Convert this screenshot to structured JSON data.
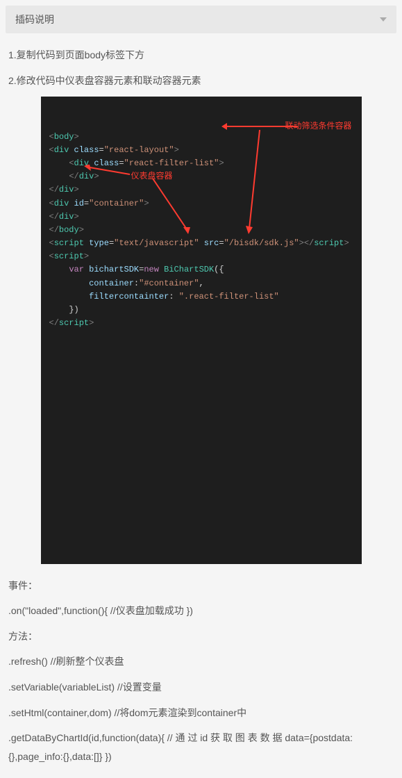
{
  "header": {
    "title": "插码说明"
  },
  "instructions": {
    "step1": "1.复制代码到页面body标签下方",
    "step2": "2.修改代码中仪表盘容器元素和联动容器元素"
  },
  "code_image": {
    "lines": [
      {
        "indent": 0,
        "tokens": [
          [
            "bracket",
            "<"
          ],
          [
            "tag",
            "body"
          ],
          [
            "bracket",
            ">"
          ]
        ]
      },
      {
        "indent": 0,
        "tokens": [
          [
            "bracket",
            "<"
          ],
          [
            "tag",
            "div"
          ],
          [
            "end",
            " "
          ],
          [
            "attr",
            "class"
          ],
          [
            "op",
            "="
          ],
          [
            "str",
            "\"react-layout\""
          ],
          [
            "bracket",
            ">"
          ]
        ]
      },
      {
        "indent": 2,
        "tokens": [
          [
            "bracket",
            "<"
          ],
          [
            "tag",
            "div"
          ],
          [
            "end",
            " "
          ],
          [
            "attr",
            "class"
          ],
          [
            "op",
            "="
          ],
          [
            "str",
            "\"react-filter-list\""
          ],
          [
            "bracket",
            ">"
          ]
        ]
      },
      {
        "indent": 2,
        "tokens": [
          [
            "bracket",
            "</"
          ],
          [
            "tag",
            "div"
          ],
          [
            "bracket",
            ">"
          ]
        ]
      },
      {
        "indent": 0,
        "tokens": [
          [
            "bracket",
            "</"
          ],
          [
            "tag",
            "div"
          ],
          [
            "bracket",
            ">"
          ]
        ]
      },
      {
        "indent": 0,
        "tokens": [
          [
            "bracket",
            "<"
          ],
          [
            "tag",
            "div"
          ],
          [
            "end",
            " "
          ],
          [
            "attr",
            "id"
          ],
          [
            "op",
            "="
          ],
          [
            "str",
            "\"container\""
          ],
          [
            "bracket",
            ">"
          ]
        ]
      },
      {
        "indent": 0,
        "tokens": [
          [
            "bracket",
            "</"
          ],
          [
            "tag",
            "div"
          ],
          [
            "bracket",
            ">"
          ]
        ]
      },
      {
        "indent": 0,
        "tokens": [
          [
            "bracket",
            "</"
          ],
          [
            "tag",
            "body"
          ],
          [
            "bracket",
            ">"
          ]
        ]
      },
      {
        "indent": 0,
        "tokens": [
          [
            "bracket",
            "<"
          ],
          [
            "tag",
            "script"
          ],
          [
            "end",
            " "
          ],
          [
            "attr",
            "type"
          ],
          [
            "op",
            "="
          ],
          [
            "str",
            "\"text/javascript\""
          ],
          [
            "end",
            " "
          ],
          [
            "attr",
            "src"
          ],
          [
            "op",
            "="
          ],
          [
            "str",
            "\"/bisdk/sdk.js\""
          ],
          [
            "bracket",
            ">"
          ],
          [
            "bracket",
            "</"
          ],
          [
            "tag",
            "script"
          ],
          [
            "bracket",
            ">"
          ]
        ]
      },
      {
        "indent": 0,
        "tokens": [
          [
            "bracket",
            "<"
          ],
          [
            "tag",
            "script"
          ],
          [
            "bracket",
            ">"
          ]
        ]
      },
      {
        "indent": 2,
        "tokens": [
          [
            "kw",
            "var"
          ],
          [
            "end",
            " "
          ],
          [
            "id",
            "bichartSDK"
          ],
          [
            "op",
            "="
          ],
          [
            "kw",
            "new"
          ],
          [
            "end",
            " "
          ],
          [
            "fn",
            "BiChartSDK"
          ],
          [
            "end",
            "({"
          ]
        ]
      },
      {
        "indent": 4,
        "tokens": [
          [
            "key",
            "container"
          ],
          [
            "end",
            ":"
          ],
          [
            "str",
            "\"#container\""
          ],
          [
            "end",
            ","
          ]
        ]
      },
      {
        "indent": 4,
        "tokens": [
          [
            "key",
            "filtercontainter"
          ],
          [
            "end",
            ": "
          ],
          [
            "str",
            "\".react-filter-list\""
          ]
        ]
      },
      {
        "indent": 2,
        "tokens": [
          [
            "end",
            "})"
          ]
        ]
      },
      {
        "indent": 0,
        "tokens": [
          [
            "bracket",
            "</"
          ],
          [
            "tag",
            "script"
          ],
          [
            "bracket",
            ">"
          ]
        ]
      }
    ],
    "annotations": {
      "filter_container": "联动筛选条件容器",
      "dashboard_container": "仪表盘容器"
    }
  },
  "api": {
    "events_label": "事件：",
    "on_loaded": ".on(\"loaded\",function(){ //仪表盘加载成功 })",
    "methods_label": "方法：",
    "refresh": ".refresh() //刷新整个仪表盘",
    "setVariable": ".setVariable(variableList) //设置变量",
    "setHtml": ".setHtml(container,dom) //将dom元素渲染到container中",
    "getData": ".getDataByChartId(id,function(data){ // 通 过 id 获 取 图 表 数 据   data={postdata:{},page_info:{},data:[]} })"
  }
}
